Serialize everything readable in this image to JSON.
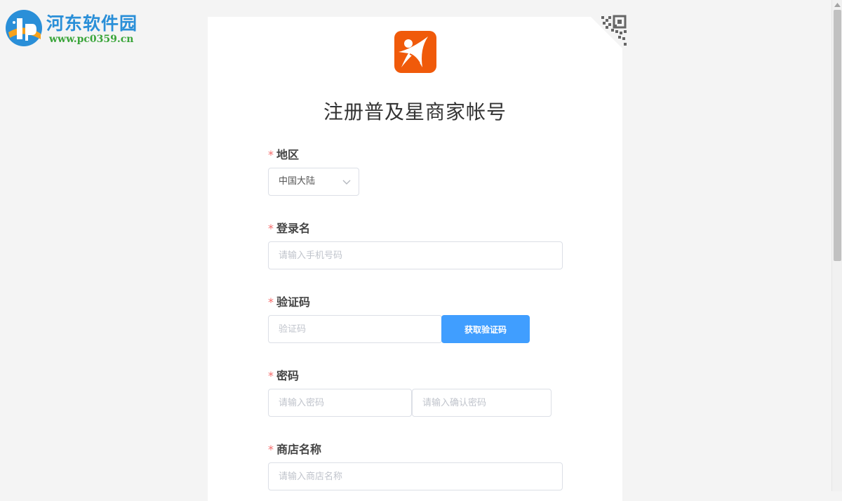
{
  "watermark": {
    "title": "河东软件园",
    "url": "www.pc0359.cn"
  },
  "page": {
    "title": "注册普及星商家帐号"
  },
  "form": {
    "required_mark": "*",
    "region": {
      "label": "地区",
      "selected": "中国大陆"
    },
    "login_name": {
      "label": "登录名",
      "placeholder": "请输入手机号码",
      "value": ""
    },
    "verify_code": {
      "label": "验证码",
      "placeholder": "验证码",
      "value": "",
      "button_label": "获取验证码"
    },
    "password": {
      "label": "密码",
      "placeholder": "请输入密码",
      "confirm_placeholder": "请输入确认密码"
    },
    "shop_name": {
      "label": "商店名称",
      "placeholder": "请输入商店名称",
      "value": ""
    }
  },
  "colors": {
    "brand_orange": "#f05a0a",
    "primary_blue": "#409eff",
    "required_red": "#f56c6c"
  },
  "icons": {
    "logo": "puji-star-logo-icon",
    "qr": "qr-code-icon",
    "dropdown": "chevron-down-icon"
  }
}
